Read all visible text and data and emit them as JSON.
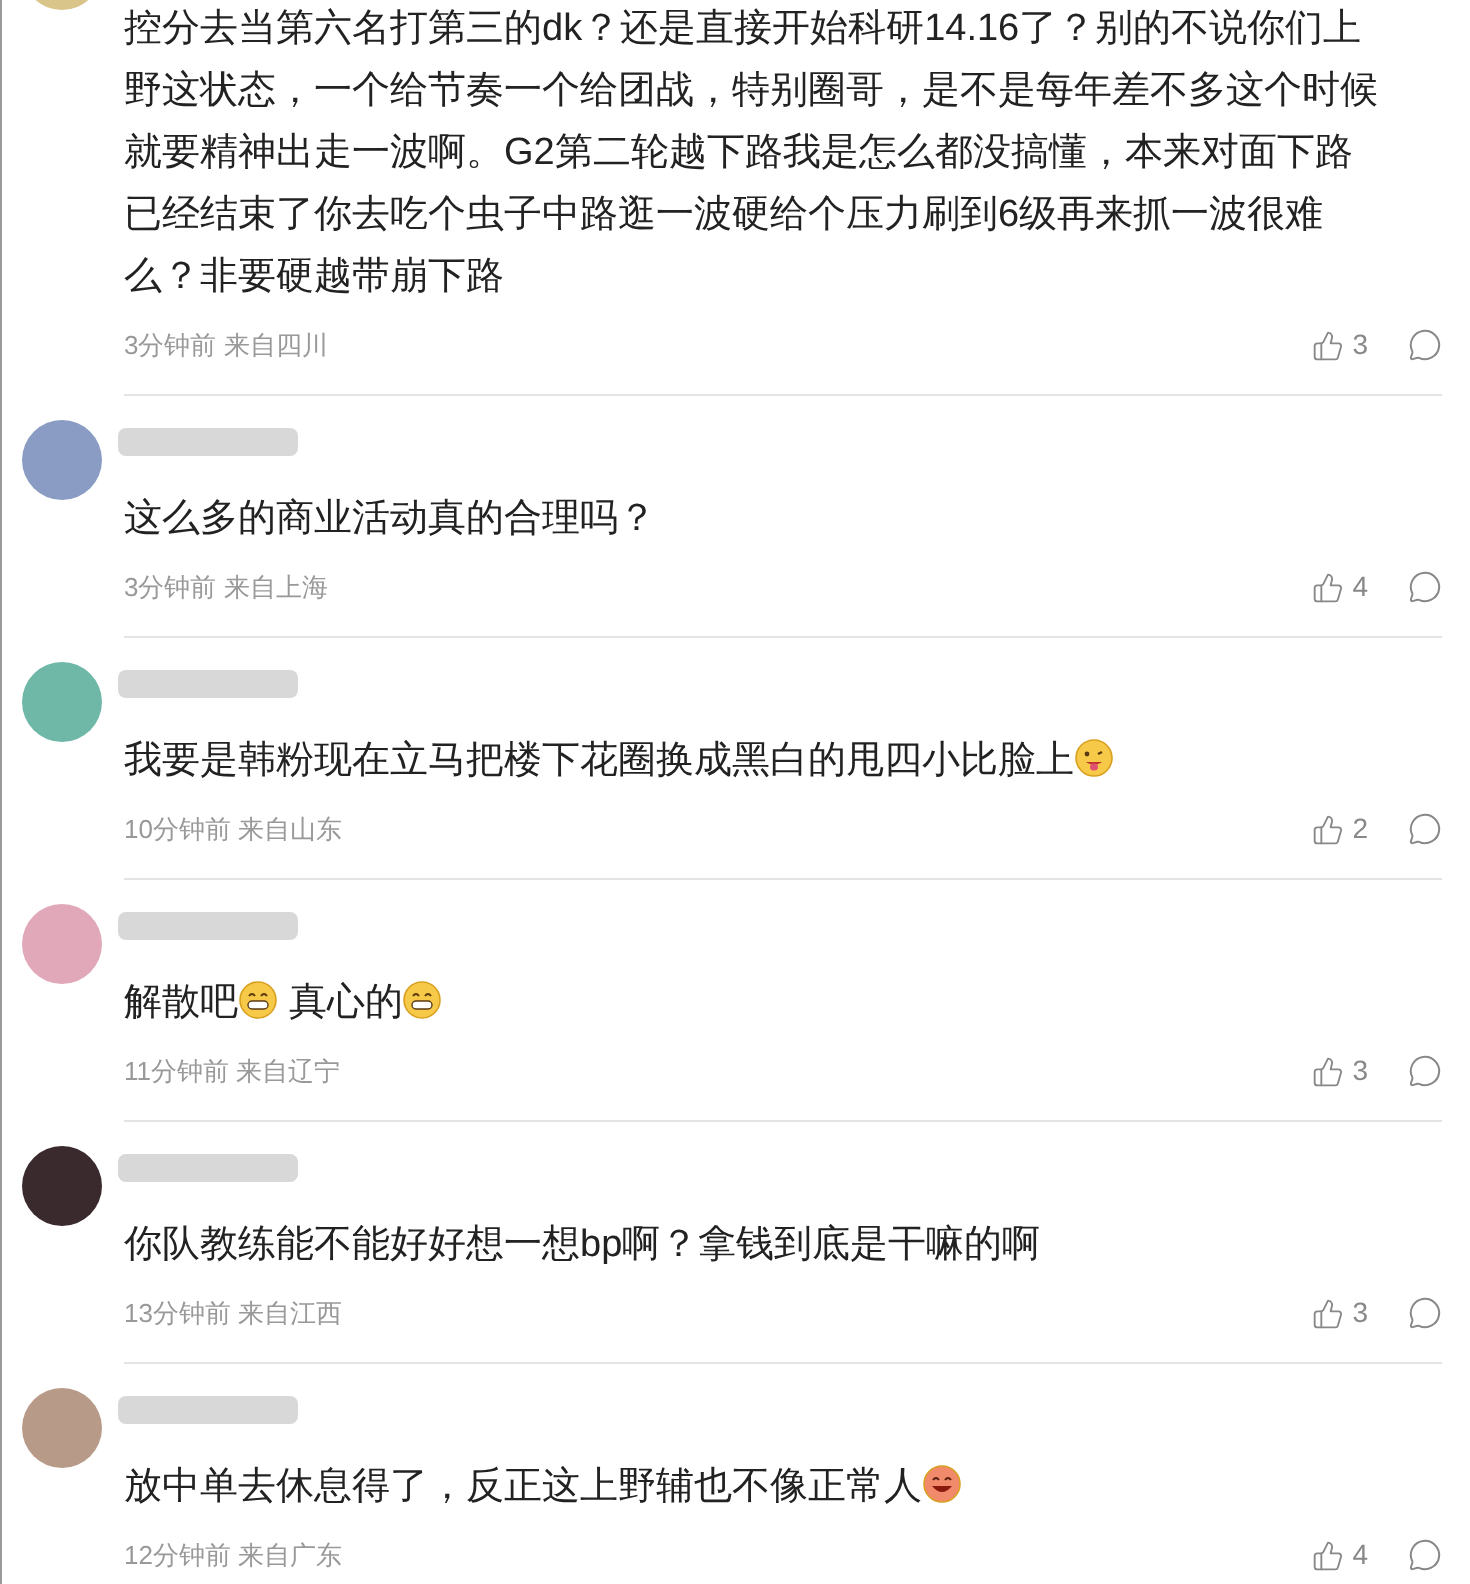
{
  "comments": [
    {
      "body": [
        {
          "kind": "text",
          "text": "控分去当第六名打第三的dk？还是直接开始科研14.16了？别的不说你们上野这状态，一个给节奏一个给团战，特别圈哥，是不是每年差不多这个时候就要精神出走一波啊。G2第二轮越下路我是怎么都没搞懂，本来对面下路已经结束了你去吃个虫子中路逛一波硬给个压力刷到6级再来抓一波很难么？非要硬越带崩下路"
        }
      ],
      "time": "3分钟前",
      "location": "来自四川",
      "likes": "3"
    },
    {
      "body": [
        {
          "kind": "text",
          "text": "这么多的商业活动真的合理吗？"
        }
      ],
      "time": "3分钟前",
      "location": "来自上海",
      "likes": "4"
    },
    {
      "body": [
        {
          "kind": "text",
          "text": "我要是韩粉现在立马把楼下花圈换成黑白的甩四小比脸上"
        },
        {
          "kind": "tongue"
        }
      ],
      "time": "10分钟前",
      "location": "来自山东",
      "likes": "2"
    },
    {
      "body": [
        {
          "kind": "text",
          "text": "解散吧"
        },
        {
          "kind": "grin"
        },
        {
          "kind": "text",
          "text": " 真心的"
        },
        {
          "kind": "grin"
        }
      ],
      "time": "11分钟前",
      "location": "来自辽宁",
      "likes": "3"
    },
    {
      "body": [
        {
          "kind": "text",
          "text": "你队教练能不能好好想一想bp啊？拿钱到底是干嘛的啊"
        }
      ],
      "time": "13分钟前",
      "location": "来自江西",
      "likes": "3"
    },
    {
      "body": [
        {
          "kind": "text",
          "text": "放中单去休息得了，反正这上野辅也不像正常人"
        },
        {
          "kind": "laugh"
        }
      ],
      "time": "12分钟前",
      "location": "来自广东",
      "likes": "4"
    }
  ]
}
